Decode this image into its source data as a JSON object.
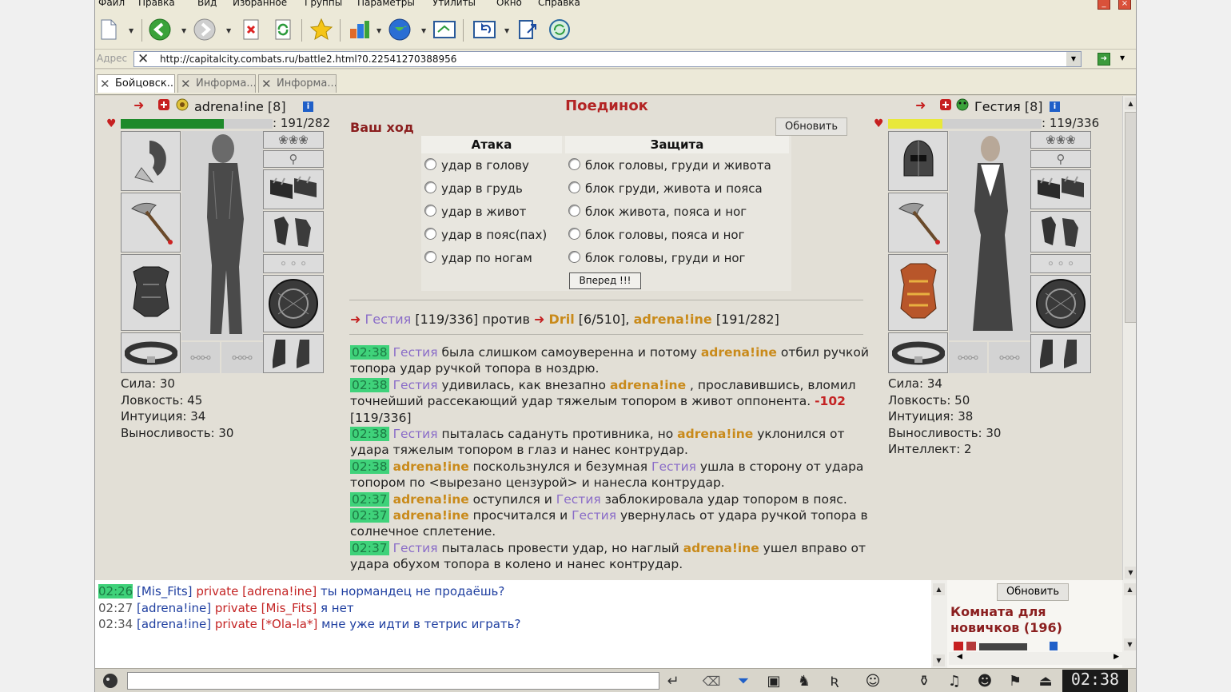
{
  "menu": [
    "Файл",
    "Правка",
    "Вид",
    "Избранное",
    "Группы",
    "Параметры",
    "Утилиты",
    "Окно",
    "Справка"
  ],
  "address": {
    "label": "Адрес",
    "url": "http://capitalcity.combats.ru/battle2.html?0.22541270388956"
  },
  "tabs": [
    "Бойцовск...",
    "Информа...",
    "Информа..."
  ],
  "battle": {
    "title": "Поединок",
    "your_turn": "Ваш ход",
    "refresh": "Обновить",
    "attack_header": "Атака",
    "defense_header": "Защита",
    "attacks": [
      "удар в голову",
      "удар в грудь",
      "удар в живот",
      "удар в пояс(пах)",
      "удар по ногам"
    ],
    "blocks": [
      "блок головы, груди и живота",
      "блок груди, живота и пояса",
      "блок живота, пояса и ног",
      "блок головы, пояса и ног",
      "блок головы, груди и ног"
    ],
    "forward": "Вперед !!!"
  },
  "player_left": {
    "name": "adrena!ine",
    "level": "[8]",
    "hp_text": ": 191/282",
    "hp_fraction": 0.677,
    "hp_color": "#1e8a2a",
    "stats": [
      "Сила: 30",
      "Ловкость: 45",
      "Интуиция: 34",
      "Выносливость: 30"
    ]
  },
  "player_right": {
    "name": "Гестия",
    "level": "[8]",
    "hp_text": ": 119/336",
    "hp_fraction": 0.354,
    "hp_color": "#e8e83a",
    "stats": [
      "Сила: 34",
      "Ловкость: 50",
      "Интуиция: 38",
      "Выносливость: 30",
      "Интеллект: 2"
    ]
  },
  "versus": {
    "p1": "Гестия",
    "p1hp": "[119/336]",
    "word": "против",
    "p2": "Dril",
    "p2hp": "[6/510],",
    "p3": "adrena!ine",
    "p3hp": "[191/282]"
  },
  "log": [
    {
      "t": "02:38",
      "segs": [
        [
          "p",
          "Гестия"
        ],
        [
          "n",
          " была слишком самоуверенна и потому "
        ],
        [
          "o",
          "adrena!ine"
        ],
        [
          "n",
          " отбил ручкой топора удар ручкой топора в ноздрю."
        ]
      ]
    },
    {
      "t": "02:38",
      "segs": [
        [
          "p",
          "Гестия"
        ],
        [
          "n",
          " удивилась, как внезапно "
        ],
        [
          "o",
          "adrena!ine"
        ],
        [
          "n",
          " , прославившись, вломил точнейший рассекающий удар тяжелым топором в живот оппонента. "
        ],
        [
          "r",
          "-102"
        ],
        [
          "n",
          " [119/336]"
        ]
      ]
    },
    {
      "t": "02:38",
      "segs": [
        [
          "p",
          "Гестия"
        ],
        [
          "n",
          " пыталась садануть противника, но "
        ],
        [
          "o",
          "adrena!ine"
        ],
        [
          "n",
          " уклонился от удара тяжелым топором в глаз и нанес контрудар."
        ]
      ]
    },
    {
      "t": "02:38",
      "segs": [
        [
          "o",
          "adrena!ine"
        ],
        [
          "n",
          " поскользнулся и безумная "
        ],
        [
          "p",
          "Гестия"
        ],
        [
          "n",
          " ушла в сторону от удара топором по <вырезано цензурой> и нанесла контрудар."
        ]
      ]
    },
    {
      "t": "02:37",
      "segs": [
        [
          "o",
          "adrena!ine"
        ],
        [
          "n",
          " оступился и "
        ],
        [
          "p",
          "Гестия"
        ],
        [
          "n",
          " заблокировала удар топором в пояс."
        ]
      ]
    },
    {
      "t": "02:37",
      "segs": [
        [
          "o",
          "adrena!ine"
        ],
        [
          "n",
          " просчитался и "
        ],
        [
          "p",
          "Гестия"
        ],
        [
          "n",
          " увернулась от удара ручкой топора в солнечное сплетение."
        ]
      ]
    },
    {
      "t": "02:37",
      "segs": [
        [
          "p",
          "Гестия"
        ],
        [
          "n",
          " пыталась провести удар, но наглый "
        ],
        [
          "o",
          "adrena!ine"
        ],
        [
          "n",
          " ушел вправо от удара обухом топора в колено и нанес контрудар."
        ]
      ]
    }
  ],
  "chat": [
    {
      "t": "02:26",
      "hl": true,
      "name": "[Mis_Fits]",
      "priv": "private [adrena!ine]",
      "msg": " ты нормандец не продаёшь?"
    },
    {
      "t": "02:27",
      "hl": false,
      "name": "[adrena!ine]",
      "priv": "private [Mis_Fits]",
      "msg": " я нет"
    },
    {
      "t": "02:34",
      "hl": false,
      "name": "[adrena!ine]",
      "priv": "private [*Ola-la*]",
      "msg": " мне уже идти в тетрис играть?"
    }
  ],
  "room": {
    "refresh": "Обновить",
    "title_line1": "Комната для",
    "title_line2": "новичков (196)"
  },
  "clock": "02:38"
}
